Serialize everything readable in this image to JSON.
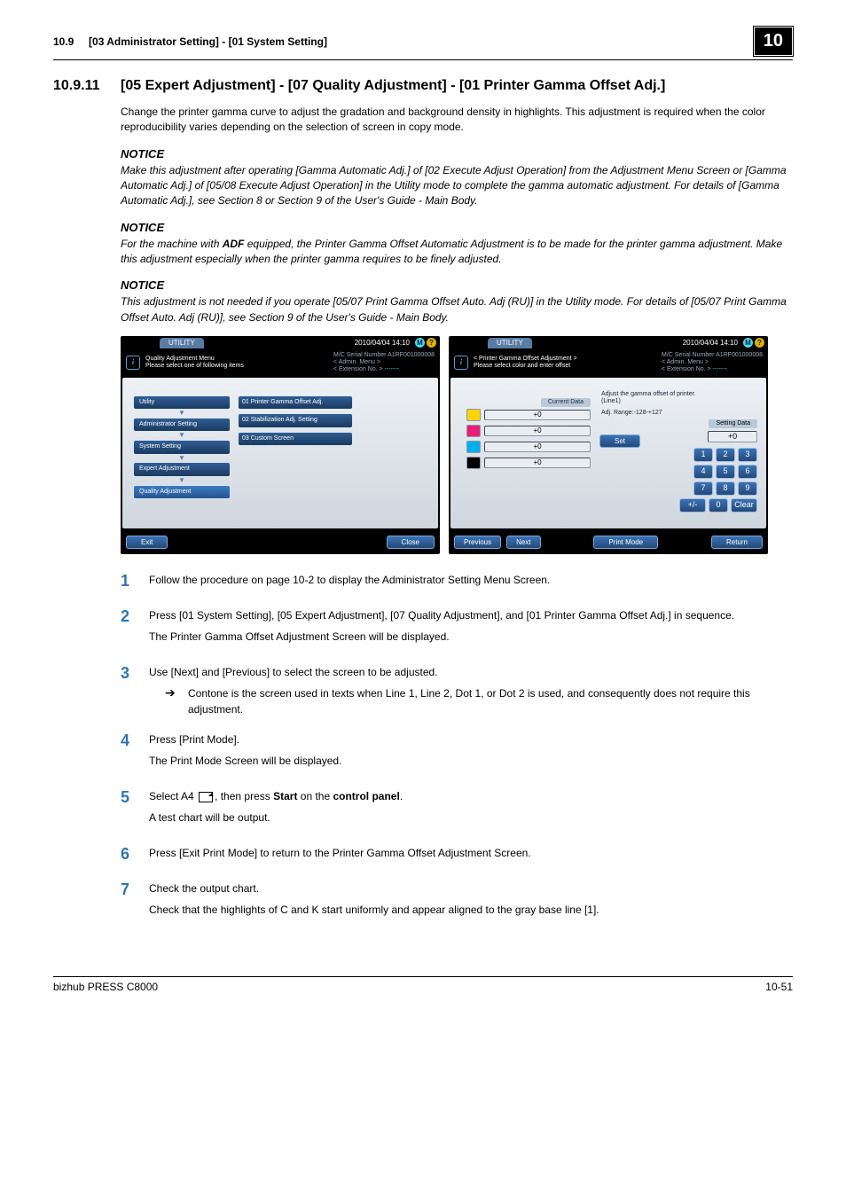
{
  "header": {
    "left_number": "10.9",
    "left_title": "[03 Administrator Setting] - [01 System Setting]",
    "chapter": "10"
  },
  "section": {
    "number": "10.9.11",
    "title": "[05 Expert Adjustment] - [07 Quality Adjustment] - [01 Printer Gamma Offset Adj.]"
  },
  "intro": "Change the printer gamma curve to adjust the gradation and background density in highlights. This adjustment is required when the color reproducibility varies depending on the selection of screen in copy mode.",
  "notices": [
    {
      "head": "NOTICE",
      "body": "Make this adjustment after operating [Gamma Automatic Adj.] of [02 Execute Adjust Operation] from the Adjustment Menu Screen or [Gamma Automatic Adj.] of [05/08 Execute Adjust Operation] in the Utility mode to complete the gamma automatic adjustment. For details of [Gamma Automatic Adj.], see Section 8 or Section 9 of the User's Guide - Main Body."
    },
    {
      "head": "NOTICE",
      "body_pre": "For the machine with ",
      "bold": "ADF",
      "body_post": " equipped, the Printer Gamma Offset Automatic Adjustment is to be made for the printer gamma adjustment. Make this adjustment especially when the printer gamma requires to be finely adjusted."
    },
    {
      "head": "NOTICE",
      "body": "This adjustment is not needed if you operate [05/07 Print Gamma Offset Auto. Adj (RU)] in the Utility mode. For details of [05/07 Print Gamma Offset Auto. Adj (RU)], see Section 9 of the User's Guide - Main Body."
    }
  ],
  "screen_common": {
    "tab": "UTILITY",
    "date": "2010/04/04 14:10",
    "serial_label": "M/C Serial Number",
    "serial_value": "A1RF001000008",
    "admin_label": "< Admin. Menu >",
    "ext_label": "< Extension No. >",
    "ext_dash": "-------"
  },
  "screen_left": {
    "title_line1": "Quality Adjustment Menu",
    "title_line2": "Please select one of following items",
    "crumbs": [
      "Utility",
      "Administrator Setting",
      "System Setting",
      "Expert Adjustment",
      "Quality Adjustment"
    ],
    "options": [
      "01 Printer Gamma Offset Adj.",
      "02 Stabilization Adj. Setting",
      "03 Custom Screen"
    ],
    "exit": "Exit",
    "close": "Close"
  },
  "screen_right": {
    "title_line1": "< Printer Gamma Offset Adjustment >",
    "title_line2": "Please select color and enter offset",
    "current_label": "Current Data",
    "values": [
      "+0",
      "+0",
      "+0",
      "+0"
    ],
    "info1": "Adjust the gamma offset of printer.",
    "info2": "(Line1)",
    "range": "Adj. Range:-128-+127",
    "set_btn": "Set",
    "setting_label": "Setting Data",
    "setting_value": "+0",
    "keypad_row1": [
      "1",
      "2",
      "3"
    ],
    "keypad_row2": [
      "4",
      "5",
      "6"
    ],
    "keypad_row3": [
      "7",
      "8",
      "9"
    ],
    "keypad_row4": [
      "+/-",
      "0",
      "Clear"
    ],
    "previous": "Previous",
    "next": "Next",
    "print_mode": "Print Mode",
    "return": "Return"
  },
  "steps": [
    {
      "num": "1",
      "body": [
        "Follow the procedure on page 10-2 to display the Administrator Setting Menu Screen."
      ]
    },
    {
      "num": "2",
      "body": [
        "Press [01 System Setting], [05 Expert Adjustment], [07 Quality Adjustment], and [01 Printer Gamma Offset Adj.] in sequence.",
        "The Printer Gamma Offset Adjustment Screen will be displayed."
      ]
    },
    {
      "num": "3",
      "body": [
        "Use [Next] and [Previous] to select the screen to be adjusted."
      ],
      "sub": "Contone is the screen used in texts when Line 1, Line 2, Dot 1, or Dot 2 is used, and consequently does not require this adjustment."
    },
    {
      "num": "4",
      "body": [
        "Press [Print Mode].",
        "The Print Mode Screen will be displayed."
      ]
    },
    {
      "num": "5",
      "body_composed": {
        "pre": "Select A4 ",
        "post1": ", then press ",
        "b1": "Start",
        "post2": " on the ",
        "b2": "control panel",
        "post3": "."
      },
      "body2": "A test chart will be output."
    },
    {
      "num": "6",
      "body": [
        "Press [Exit Print Mode] to return to the Printer Gamma Offset Adjustment Screen."
      ]
    },
    {
      "num": "7",
      "body": [
        "Check the output chart.",
        "Check that the highlights of C and K start uniformly and appear aligned to the gray base line [1]."
      ]
    }
  ],
  "footer": {
    "left": "bizhub PRESS C8000",
    "right": "10-51"
  }
}
